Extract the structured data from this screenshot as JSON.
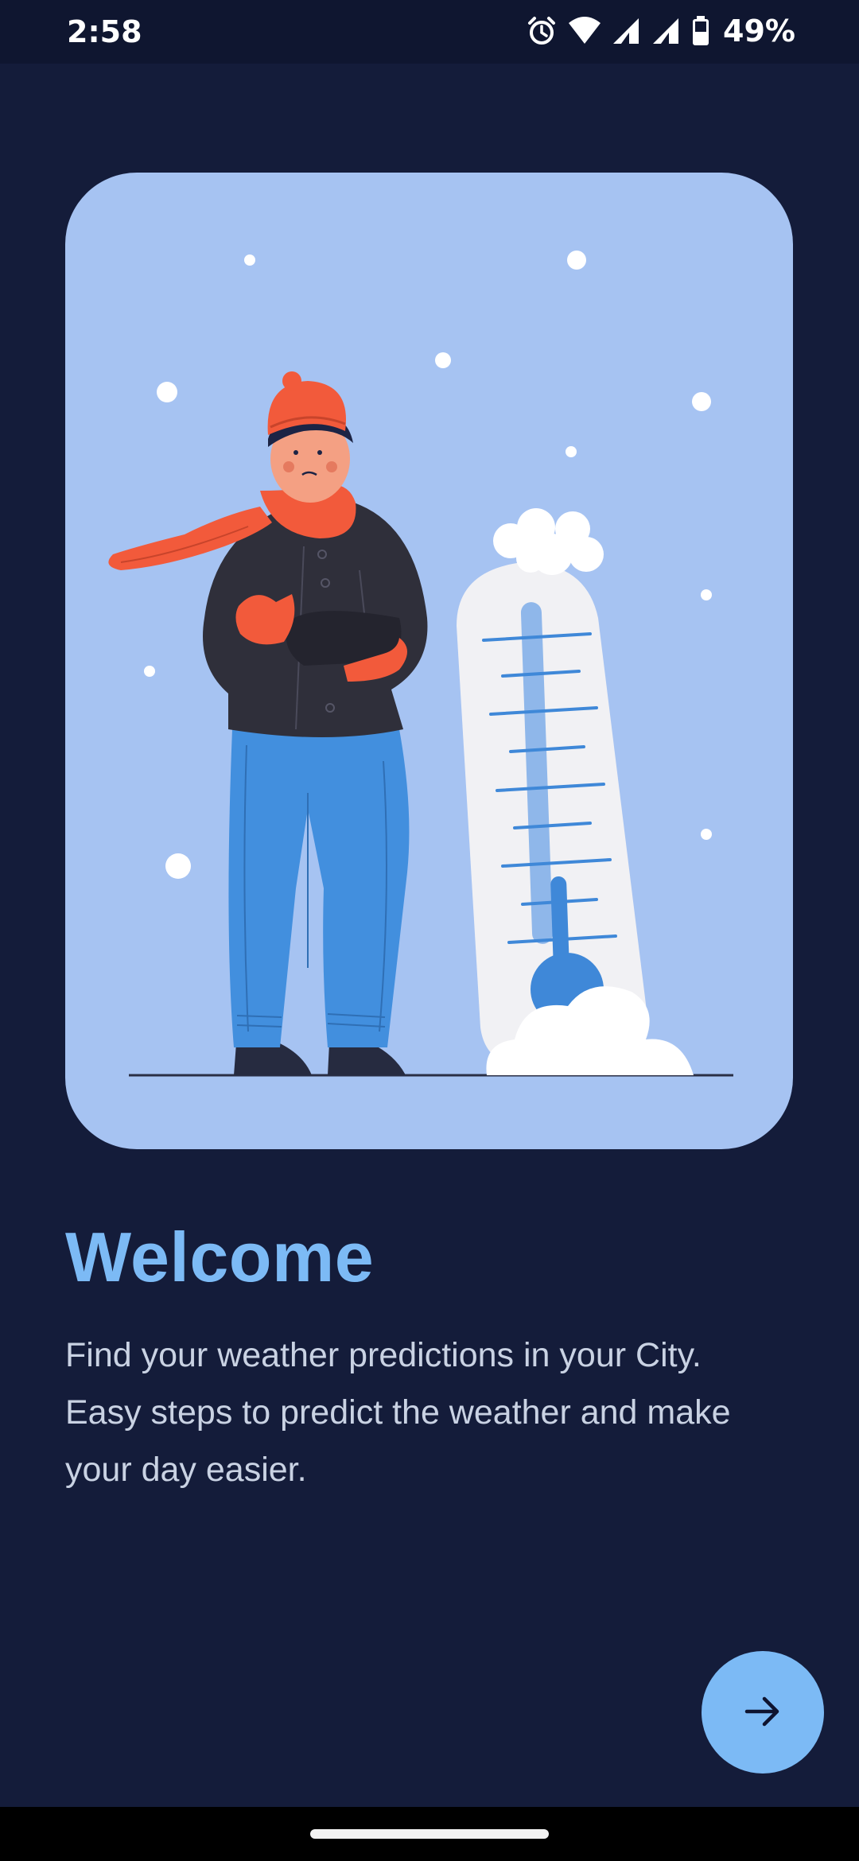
{
  "status_bar": {
    "time": "2:58",
    "battery_percent": "49%",
    "icons": [
      "alarm-icon",
      "wifi-icon",
      "signal-icon",
      "signal-icon",
      "battery-icon"
    ]
  },
  "welcome": {
    "title": "Welcome",
    "line1": "Find your weather predictions in your City.",
    "line2": "Easy steps to predict the weather and make",
    "line3": "your day easier."
  },
  "next_button": {
    "icon": "arrow-right-icon"
  },
  "colors": {
    "background": "#141c3a",
    "card": "#a6c3f2",
    "accent": "#7cbaf5",
    "body_text": "#c9d2e3",
    "scarf_hat": "#f25a3b",
    "jacket": "#2f2f3a",
    "jeans": "#428fde"
  }
}
